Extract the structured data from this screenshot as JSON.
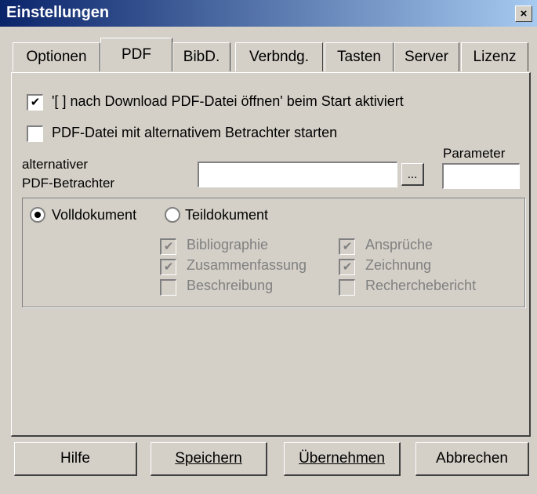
{
  "window": {
    "title": "Einstellungen",
    "close": "×"
  },
  "tabs": [
    {
      "label": "Optionen"
    },
    {
      "label": "PDF"
    },
    {
      "label": "BibD."
    },
    {
      "label": "Verbndg."
    },
    {
      "label": "Tasten"
    },
    {
      "label": "Server"
    },
    {
      "label": "Lizenz"
    }
  ],
  "pdf": {
    "open_after_download": {
      "label": "'[ ] nach Download PDF-Datei öffnen' beim Start aktiviert",
      "checked": true
    },
    "alt_viewer_start": {
      "label": "PDF-Datei mit alternativem Betrachter starten",
      "checked": false
    },
    "alt_viewer_label_1": "alternativer",
    "alt_viewer_label_2": "PDF-Betrachter",
    "alt_viewer_value": "",
    "browse_label": "...",
    "parameter_label": "Parameter",
    "parameter_value": ""
  },
  "document_scope": {
    "full": {
      "label": "Volldokument",
      "selected": true
    },
    "partial": {
      "label": "Teildokument",
      "selected": false
    },
    "parts": [
      {
        "label": "Bibliographie",
        "checked": true
      },
      {
        "label": "Ansprüche",
        "checked": true
      },
      {
        "label": "Zusammenfassung",
        "checked": true
      },
      {
        "label": "Zeichnung",
        "checked": true
      },
      {
        "label": "Beschreibung",
        "checked": false
      },
      {
        "label": "Recherchebericht",
        "checked": false
      }
    ]
  },
  "buttons": {
    "help": "Hilfe",
    "save": "Speichern",
    "apply": "Übernehmen",
    "cancel": "Abbrechen"
  }
}
